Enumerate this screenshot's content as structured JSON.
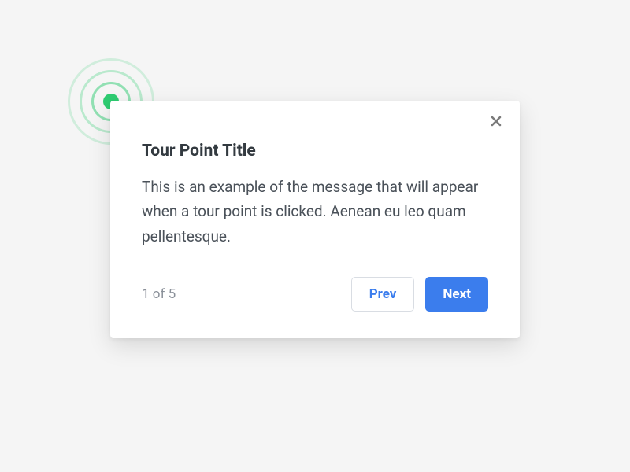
{
  "popover": {
    "title": "Tour Point Title",
    "message": "This is an example of the message that will appear when a tour point is clicked. Aenean eu leo quam pellentesque.",
    "counter": "1 of 5",
    "prev_label": "Prev",
    "next_label": "Next"
  }
}
